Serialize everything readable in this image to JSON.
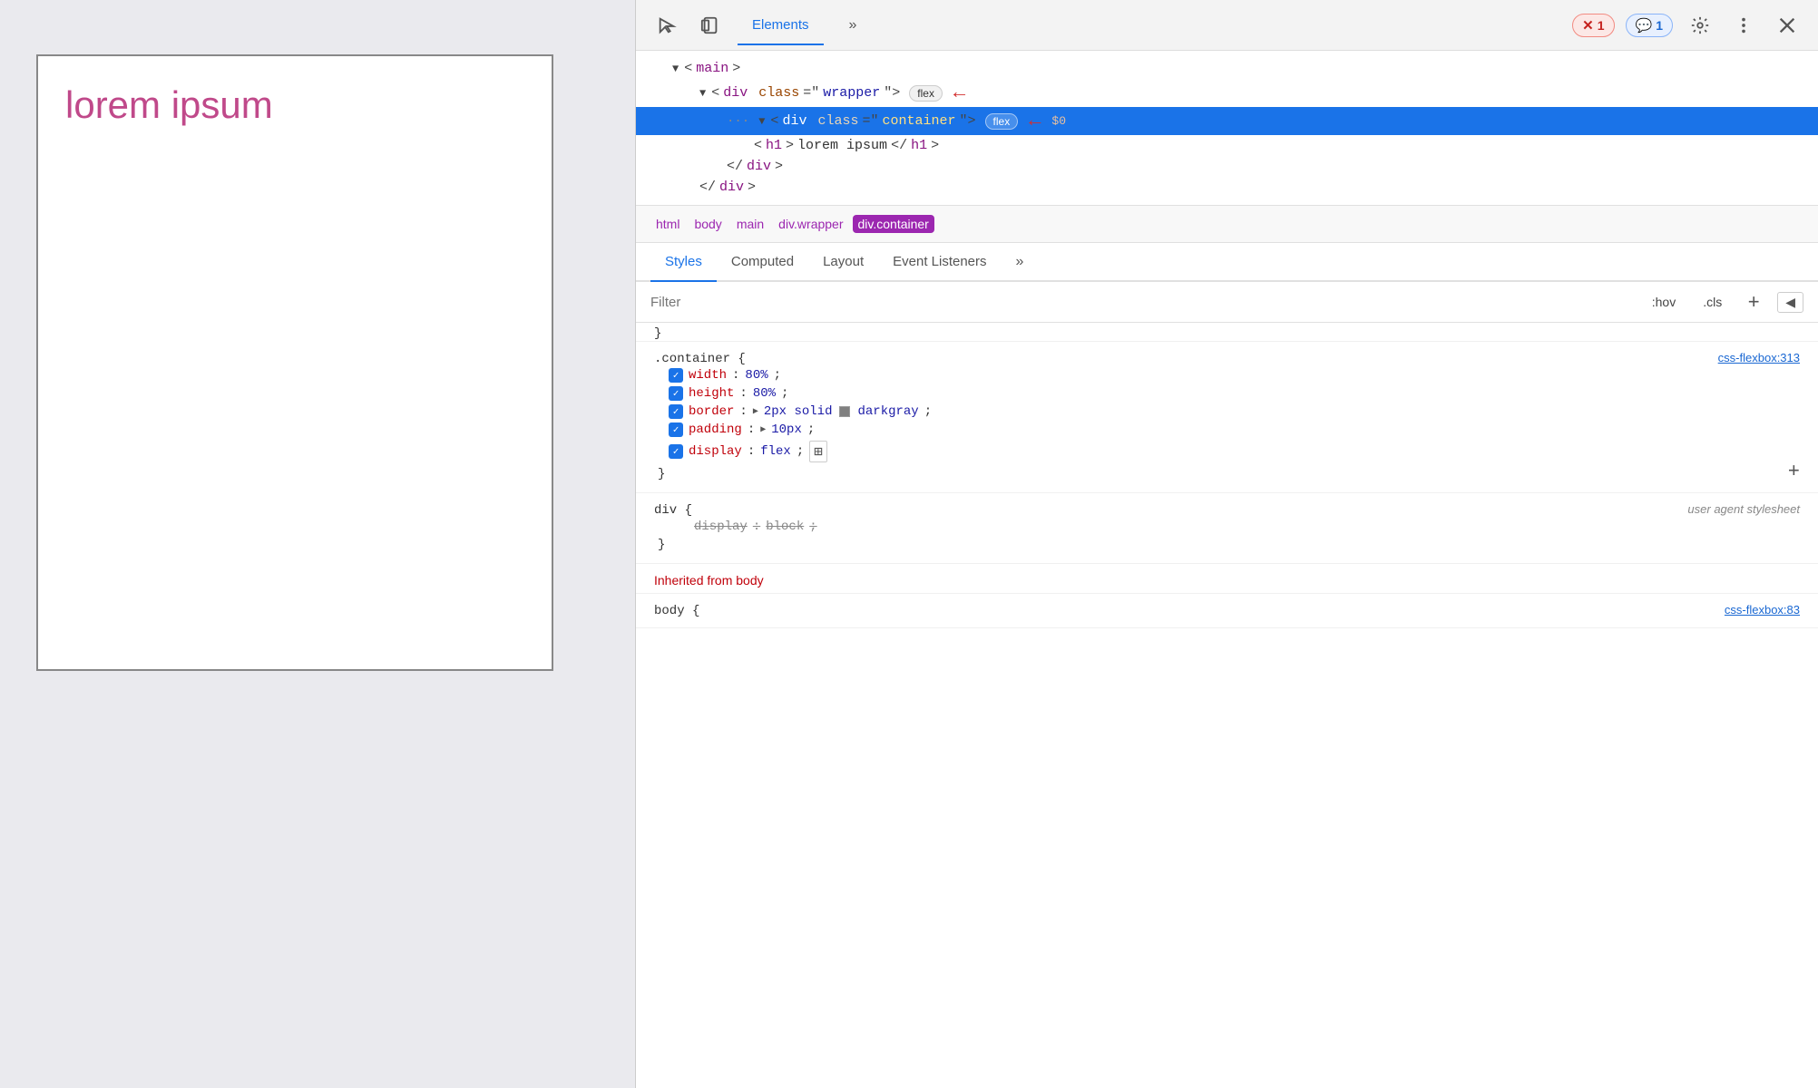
{
  "browser": {
    "lorem_text": "lorem ipsum"
  },
  "devtools": {
    "toolbar": {
      "elements_tab": "Elements",
      "error_badge": "1",
      "message_badge": "1"
    },
    "html_tree": {
      "main_tag": "<main>",
      "wrapper_open": "<div class=\"wrapper\">",
      "wrapper_flex_badge": "flex",
      "container_open": "<div class=\"container\">",
      "container_flex_badge": "flex",
      "h1_tag": "<h1>lorem ipsum</h1>",
      "div_close": "</div>",
      "div_close2": "</div>"
    },
    "breadcrumb": {
      "items": [
        "html",
        "body",
        "main",
        "div.wrapper",
        "div.container"
      ]
    },
    "tabs": {
      "items": [
        "Styles",
        "Computed",
        "Layout",
        "Event Listeners"
      ],
      "active": "Styles"
    },
    "filter": {
      "placeholder": "Filter",
      "hov_label": ":hov",
      "cls_label": ".cls"
    },
    "styles": {
      "partial_rule_open": "}",
      "container_rule": {
        "selector": ".container {",
        "source": "css-flexbox:313",
        "props": [
          {
            "prop": "width",
            "value": "80%",
            "checked": true
          },
          {
            "prop": "height",
            "value": "80%",
            "checked": true
          },
          {
            "prop": "border",
            "value": "2px solid darkgray",
            "checked": true,
            "has_arrow": true,
            "has_swatch": true
          },
          {
            "prop": "padding",
            "value": "10px",
            "checked": true,
            "has_arrow": true
          },
          {
            "prop": "display",
            "value": "flex",
            "checked": true,
            "has_flex_icon": true
          }
        ],
        "close": "}"
      },
      "div_rule": {
        "selector": "div {",
        "source_label": "user agent stylesheet",
        "props": [
          {
            "prop": "display",
            "value": "block",
            "strikethrough": true
          }
        ],
        "close": "}"
      },
      "inherited_label": "Inherited from",
      "inherited_from": "body",
      "body_rule": {
        "selector": "body {",
        "source": "css-flexbox:83"
      }
    }
  }
}
